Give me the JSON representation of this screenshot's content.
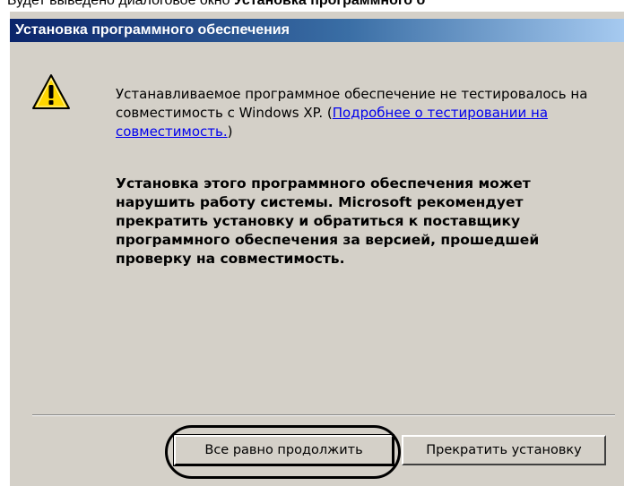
{
  "caption": {
    "prefix": "Будет выведено диалоговое окно ",
    "bold": "Установка программного о"
  },
  "dialog": {
    "title": "Установка программного обеспечения",
    "message_before_link": "Устанавливаемое программное обеспечение не тестировалось на совместимость с Windows XP. (",
    "link_text": "Подробнее о тестировании на совместимость.",
    "message_after_link": ")",
    "warning_text": "Установка этого программного обеспечения может нарушить работу системы. Microsoft рекомендует прекратить установку и обратиться к поставщику программного обеспечения за версией, прошедшей проверку на совместимость.",
    "buttons": {
      "continue_label": "Все равно продолжить",
      "stop_label": "Прекратить установку"
    }
  },
  "icons": {
    "warning": "warning-icon"
  },
  "colors": {
    "titlebar_start": "#0a246a",
    "titlebar_end": "#a6caf0",
    "dialog_bg": "#d4d0c8",
    "link": "#0000ee",
    "warning_fill": "#ffd700"
  }
}
